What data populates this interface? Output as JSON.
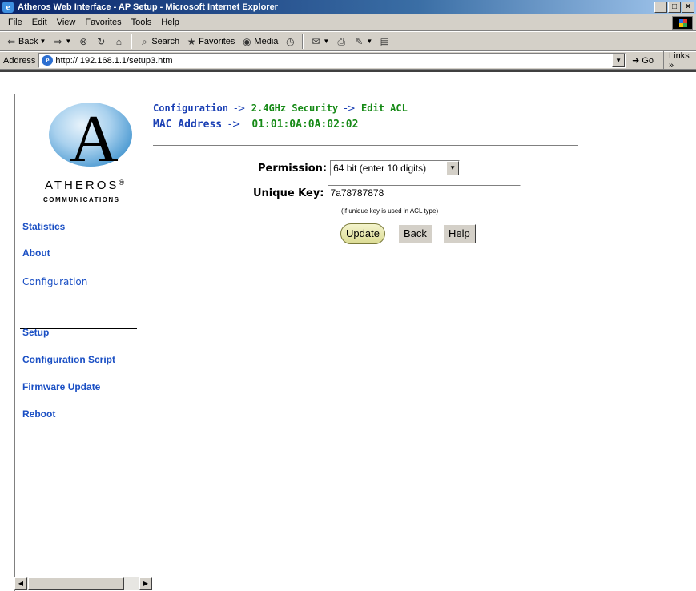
{
  "window": {
    "title": "Atheros Web Interface - AP Setup - Microsoft Internet Explorer",
    "app_icon": "ie-icon",
    "controls": [
      "_",
      "□",
      "×"
    ]
  },
  "menu": {
    "items": [
      "File",
      "Edit",
      "View",
      "Favorites",
      "Tools",
      "Help"
    ]
  },
  "toolbar": {
    "back_label": "Back",
    "search_label": "Search",
    "favorites_label": "Favorites",
    "media_label": "Media"
  },
  "address": {
    "label": "Address",
    "url": "http:// 192.168.1.1/setup3.htm",
    "go_label": "Go",
    "links_label": "Links"
  },
  "logo": {
    "letter": "A",
    "brand": "ATHEROS",
    "reg": "®",
    "sub": "COMMUNICATIONS"
  },
  "nav": {
    "statistics": "Statistics",
    "about": "About",
    "configuration": "Configuration",
    "setup": "Setup",
    "config_script": "Configuration Script",
    "firmware": "Firmware Update",
    "reboot": "Reboot"
  },
  "breadcrumb": {
    "part1": "Configuration",
    "arrow": "->",
    "part2": "2.4GHz Security",
    "part3": "Edit ACL"
  },
  "mac": {
    "label": "MAC Address",
    "arrow": "->",
    "value": "01:01:0A:0A:02:02"
  },
  "form": {
    "permission_label": "Permission:",
    "permission_value": "64 bit (enter 10 digits)",
    "unique_key_label": "Unique Key:",
    "unique_key_value": "7a78787878",
    "hint": "(If unique key is used in ACL type)",
    "update_label": "Update",
    "back_label": "Back",
    "help_label": "Help"
  },
  "colors": {
    "link_blue": "#1a4fc4",
    "crumb_green": "#168a16",
    "titlebar": "#0a246a"
  }
}
